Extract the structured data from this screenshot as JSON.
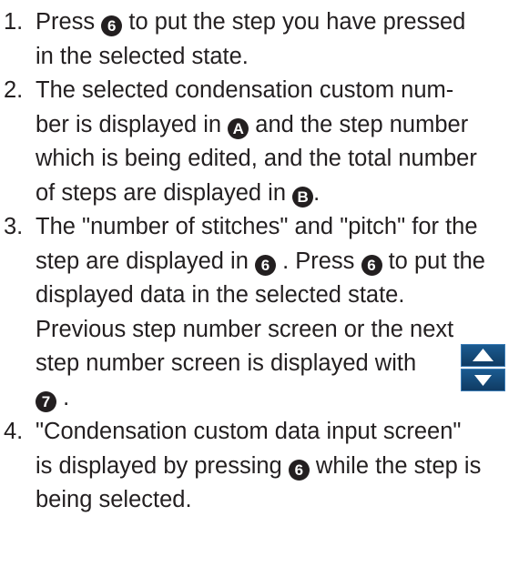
{
  "items": [
    {
      "number": "1.",
      "lines": [
        [
          {
            "text": "Press "
          },
          {
            "glyph": "6"
          },
          {
            "text": " to put the step you have pressed"
          }
        ],
        [
          {
            "text": "in the selected state."
          }
        ]
      ]
    },
    {
      "number": "2.",
      "lines": [
        [
          {
            "text": "The selected condensation custom num-"
          }
        ],
        [
          {
            "text": "ber is displayed in "
          },
          {
            "glyph": "A"
          },
          {
            "text": " and the step number"
          }
        ],
        [
          {
            "text": "which is being edited, and the total number"
          }
        ],
        [
          {
            "text": "of steps are displayed in "
          },
          {
            "glyph": "B"
          },
          {
            "text": "."
          }
        ]
      ]
    },
    {
      "number": "3.",
      "lines": [
        [
          {
            "text": "The \"number of stitches\" and \"pitch\" for the"
          }
        ],
        [
          {
            "text": "step are displayed in "
          },
          {
            "glyph": "6"
          },
          {
            "text": " . Press "
          },
          {
            "glyph": "6"
          },
          {
            "text": " to put the"
          }
        ],
        [
          {
            "text": "displayed data in the selected state."
          }
        ],
        [
          {
            "text": "Previous step number screen or the next"
          }
        ],
        [
          {
            "text": "step number screen is displayed with"
          }
        ],
        [
          {
            "glyph": "7"
          },
          {
            "text": " ."
          }
        ]
      ]
    },
    {
      "number": "4.",
      "lines": [
        [
          {
            "text": "\"Condensation custom data input screen\""
          }
        ],
        [
          {
            "text": "is displayed by pressing "
          },
          {
            "glyph": "6"
          },
          {
            "text": " while the step is"
          }
        ],
        [
          {
            "text": "being selected."
          }
        ]
      ]
    }
  ],
  "colors": {
    "text": "#231f20",
    "button_blue": "#1b5c92",
    "arrow": "#ffffff"
  },
  "icons": {
    "updown_button": "up-down-arrow-button-icon"
  }
}
